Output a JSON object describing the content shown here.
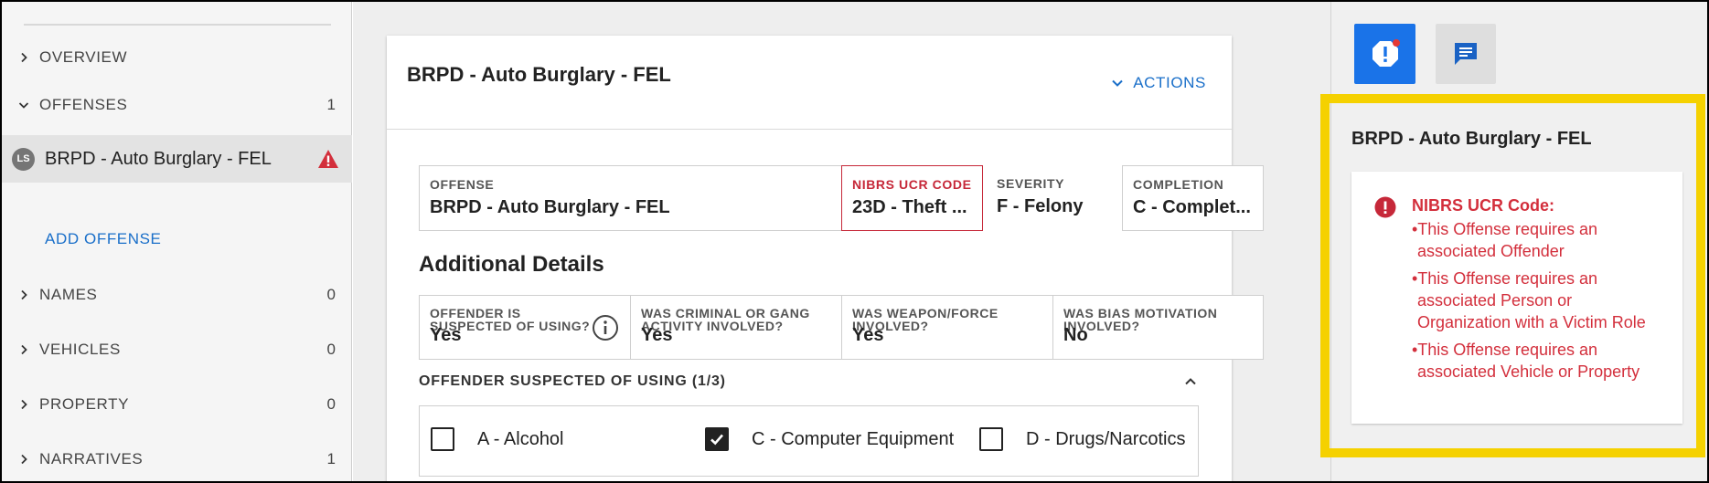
{
  "sidebar": {
    "items": [
      {
        "label": "OVERVIEW",
        "count": ""
      },
      {
        "label": "OFFENSES",
        "count": "1"
      },
      {
        "label": "BRPD - Auto Burglary - FEL",
        "avatar": "LS"
      },
      {
        "label": "NAMES",
        "count": "0"
      },
      {
        "label": "VEHICLES",
        "count": "0"
      },
      {
        "label": "PROPERTY",
        "count": "0"
      },
      {
        "label": "NARRATIVES",
        "count": "1"
      }
    ],
    "add_offense_label": "ADD OFFENSE"
  },
  "card": {
    "title": "BRPD - Auto Burglary - FEL",
    "actions_label": "ACTIONS",
    "fields": {
      "offense": {
        "label": "OFFENSE",
        "value": "BRPD - Auto Burglary - FEL"
      },
      "nibrs": {
        "label": "NIBRS UCR CODE",
        "value": "23D - Theft ..."
      },
      "severity": {
        "label": "SEVERITY",
        "value": "F - Felony"
      },
      "completion": {
        "label": "COMPLETION",
        "value": "C - Complet..."
      }
    },
    "additional_details_title": "Additional Details",
    "details": [
      {
        "label": "OFFENDER IS SUSPECTED OF USING?",
        "value": "Yes"
      },
      {
        "label": "WAS CRIMINAL OR GANG ACTIVITY INVOLVED?",
        "value": "Yes"
      },
      {
        "label": "WAS WEAPON/FORCE INVOLVED?",
        "value": "Yes"
      },
      {
        "label": "WAS BIAS MOTIVATION INVOLVED?",
        "value": "No"
      }
    ],
    "suspected_section_title": "OFFENDER SUSPECTED OF USING (1/3)",
    "checkboxes": [
      {
        "label": "A - Alcohol",
        "checked": false
      },
      {
        "label": "C - Computer Equipment",
        "checked": true
      },
      {
        "label": "D - Drugs/Narcotics",
        "checked": false
      }
    ]
  },
  "right_panel": {
    "title": "BRPD - Auto Burglary - FEL",
    "error_heading": "NIBRS UCR Code:",
    "errors": [
      "•This Offense requires an associated Offender",
      "•This Offense requires an associated Person or Organization with a Victim Role",
      "•This Offense requires an associated Vehicle or Property"
    ]
  },
  "colors": {
    "accent_blue": "#1a73e8",
    "link_blue": "#1a6fc9",
    "error_red": "#d32f3c",
    "highlight_yellow": "#f5d100"
  },
  "icons": {
    "alert_button": "alert-octagon-icon",
    "chat_button": "chat-icon",
    "warning": "warning-triangle-icon",
    "info": "info-icon",
    "error": "error-circle-icon"
  }
}
